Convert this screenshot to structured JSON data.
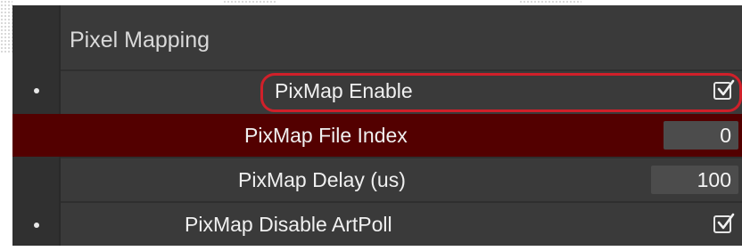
{
  "section": {
    "title": "Pixel Mapping"
  },
  "rows": [
    {
      "label": "PixMap Enable",
      "type": "checkbox",
      "checked": true,
      "has_dot": true,
      "highlighted": false,
      "outlined": true
    },
    {
      "label": "PixMap File Index",
      "type": "number",
      "value": "0",
      "has_dot": false,
      "highlighted": true,
      "outlined": false
    },
    {
      "label": "PixMap Delay (us)",
      "type": "number",
      "value": "100",
      "has_dot": false,
      "highlighted": false,
      "outlined": false
    },
    {
      "label": "PixMap Disable ArtPoll",
      "type": "checkbox",
      "checked": true,
      "has_dot": true,
      "highlighted": false,
      "outlined": false
    }
  ],
  "colors": {
    "panel_bg": "#3a3a3a",
    "highlight_row": "#530000",
    "outline_accent": "#d0202a",
    "text": "#f0f0f0"
  }
}
